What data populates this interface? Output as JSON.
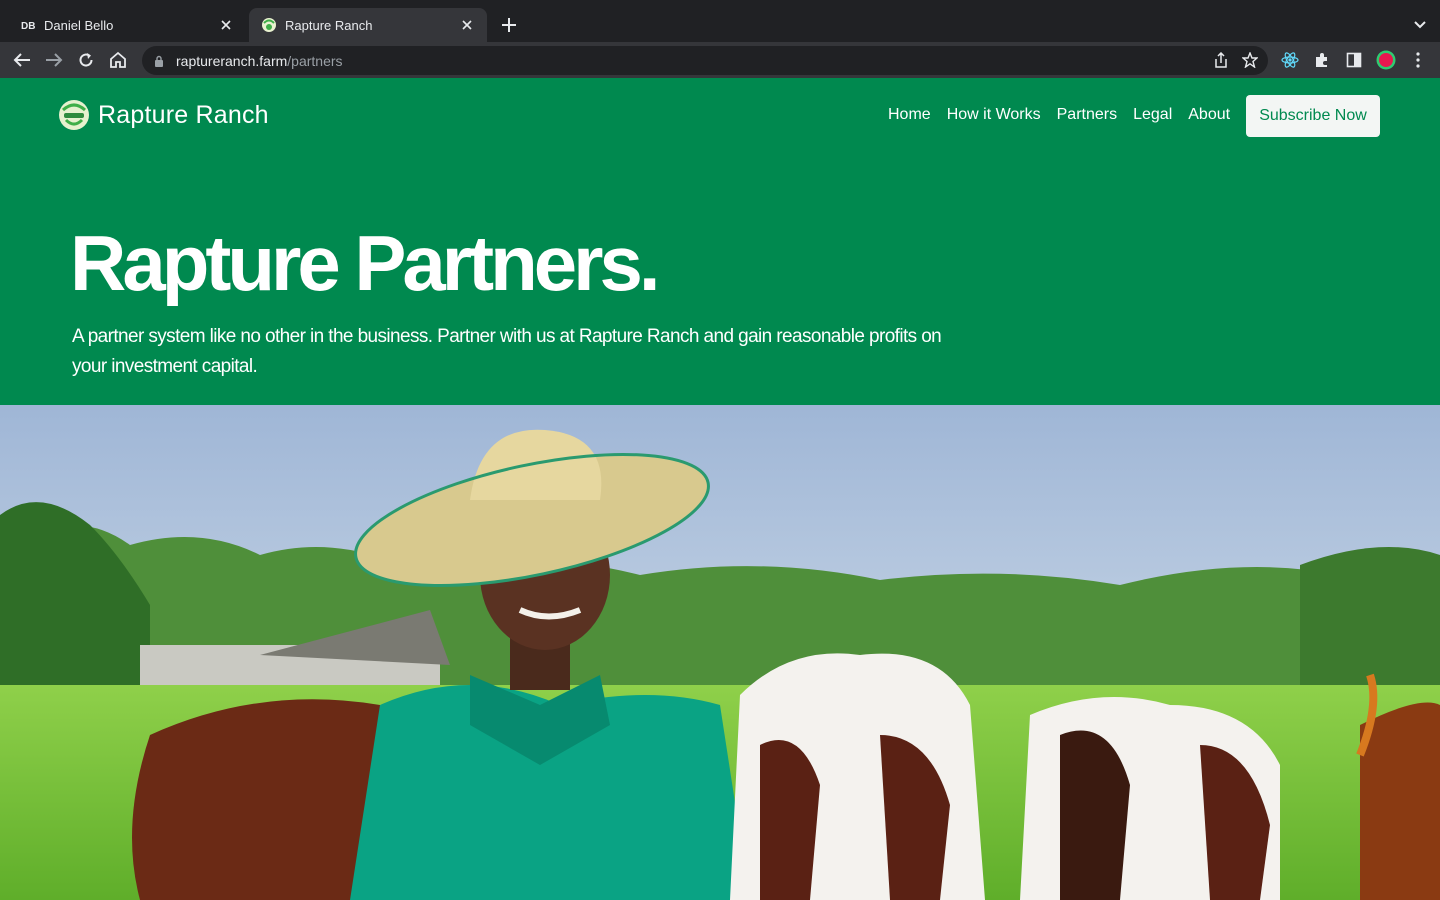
{
  "browser": {
    "tabs": [
      {
        "title": "Daniel Bello",
        "favicon_text": "DB",
        "active": false
      },
      {
        "title": "Rapture Ranch",
        "active": true
      }
    ],
    "url_host": "raptureranch.farm",
    "url_path": "/partners"
  },
  "header": {
    "brand": "Rapture Ranch",
    "nav": [
      "Home",
      "How it Works",
      "Partners",
      "Legal",
      "About"
    ],
    "cta": "Subscribe Now"
  },
  "hero": {
    "title": "Rapture Partners.",
    "subtitle": "A partner system like no other in the business. Partner with us at Rapture Ranch and gain reasonable profits on your investment capital."
  },
  "colors": {
    "brand_green": "#00894f",
    "chrome_dark": "#202124",
    "chrome_mid": "#35363a"
  }
}
